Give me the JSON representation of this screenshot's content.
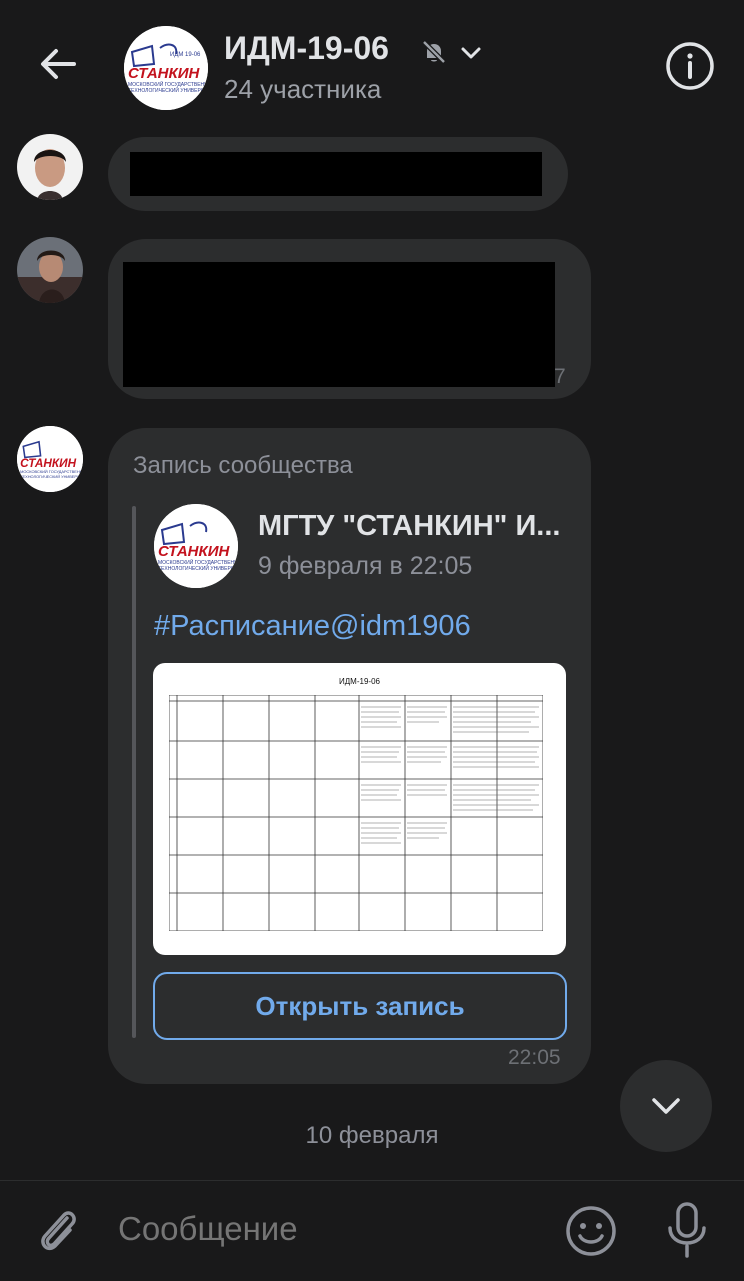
{
  "header": {
    "title": "ИДМ-19-06",
    "subtitle": "24 участника",
    "logo_text_main": "СТАНКИН",
    "logo_text_small": "МОСКОВСКИЙ ГОСУДАРСТВЕННЫЙ ТЕХНОЛОГИЧЕСКИЙ УНИВЕРСИТЕТ",
    "logo_text_top": "ИДМ 19-06 (УЗТС)"
  },
  "messages": {
    "message_2_time_fragment": "7"
  },
  "post": {
    "label": "Запись сообщества",
    "author": "МГТУ \"СТАНКИН\" И...",
    "date": "9 февраля в 22:05",
    "hashtag": "#Расписание@idm1906",
    "open_button": "Открыть запись",
    "time": "22:05",
    "schedule_title": "ИДМ-19-06"
  },
  "date_separator": "10 февраля",
  "composer": {
    "placeholder": "Сообщение"
  },
  "colors": {
    "background": "#19191a",
    "bubble": "#2c2d2e",
    "accent": "#71aaeb",
    "secondary_text": "#8d9099"
  },
  "icons": {
    "back": "arrow-left-icon",
    "mute": "bell-off-icon",
    "dropdown": "chevron-down-icon",
    "info": "info-icon",
    "attach": "paperclip-icon",
    "emoji": "smile-icon",
    "mic": "microphone-icon",
    "scroll": "chevron-down-icon"
  }
}
